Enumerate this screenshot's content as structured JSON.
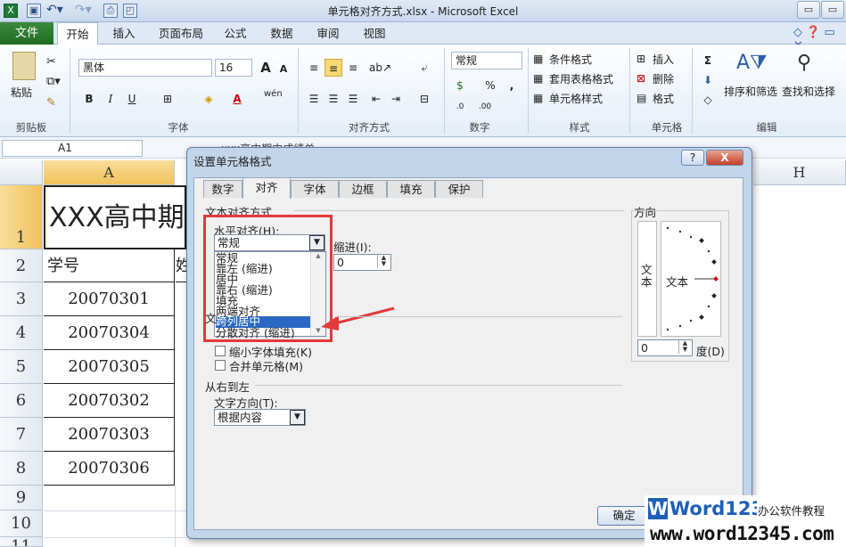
{
  "window": {
    "title": "单元格对齐方式.xlsx - Microsoft Excel"
  },
  "quick_access": {
    "icons": [
      "excel-logo",
      "save",
      "undo",
      "redo",
      "print",
      "print-preview"
    ]
  },
  "tabs": {
    "file": "文件",
    "items": [
      "开始",
      "插入",
      "页面布局",
      "公式",
      "数据",
      "审阅",
      "视图"
    ],
    "active": "开始"
  },
  "ribbon": {
    "clipboard": {
      "paste": "粘贴",
      "group": "剪贴板"
    },
    "font": {
      "name": "黑体",
      "size": "16",
      "bold": "B",
      "italic": "I",
      "underline": "U",
      "grow": "A",
      "shrink": "A",
      "font_color": "A",
      "wen": "wén",
      "group": "字体"
    },
    "alignment": {
      "group": "对齐方式"
    },
    "number": {
      "format": "常规",
      "percent": "%",
      "comma": ",",
      "group": "数字"
    },
    "styles": {
      "conditional": "条件格式",
      "table": "套用表格格式",
      "cell_styles": "单元格样式",
      "group": "样式"
    },
    "cells": {
      "insert": "插入",
      "delete": "删除",
      "format": "格式",
      "group": "单元格"
    },
    "editing": {
      "sum": "Σ",
      "sort_filter": "排序和筛选",
      "find_select": "查找和选择",
      "group": "编辑"
    }
  },
  "formula_bar": {
    "name_box": "A1",
    "content": "xxx高中期中成绩单"
  },
  "sheet": {
    "columns": [
      "A",
      "H"
    ],
    "rows": [
      "1",
      "2",
      "3",
      "4",
      "5",
      "6",
      "7",
      "8",
      "9",
      "10",
      "11"
    ],
    "cells": {
      "a1": "XXX高中期",
      "a2": "学号",
      "b2": "姓",
      "ids": [
        "20070301",
        "20070304",
        "20070305",
        "20070302",
        "20070303",
        "20070306"
      ]
    }
  },
  "dialog": {
    "title": "设置单元格格式",
    "help": "?",
    "close": "X",
    "tabs": [
      "数字",
      "对齐",
      "字体",
      "边框",
      "填充",
      "保护"
    ],
    "active_tab": "对齐",
    "text_alignment": {
      "section": "文本对齐方式",
      "horizontal_label": "水平对齐(H):",
      "horizontal_value": "常规",
      "indent_label": "缩进(I):",
      "indent_value": "0",
      "options": [
        "常规",
        "靠左 (缩进)",
        "居中",
        "靠右 (缩进)",
        "填充",
        "两端对齐",
        "跨列居中",
        "分散对齐 (缩进)"
      ],
      "highlighted": "跨列居中"
    },
    "text_control": {
      "section": "文",
      "shrink": "缩小字体填充(K)",
      "merge": "合并单元格(M)"
    },
    "rtl": {
      "section": "从右到左",
      "direction_label": "文字方向(T):",
      "direction_value": "根据内容"
    },
    "orientation": {
      "section": "方向",
      "vertical_text": "文本",
      "horizontal_text": "文本",
      "degrees_value": "0",
      "degrees_label": "度(D)"
    },
    "ok": "确定"
  },
  "watermark": {
    "brand": "Word12345",
    "tagline": "办公软件教程",
    "url": "www.word12345.com"
  }
}
